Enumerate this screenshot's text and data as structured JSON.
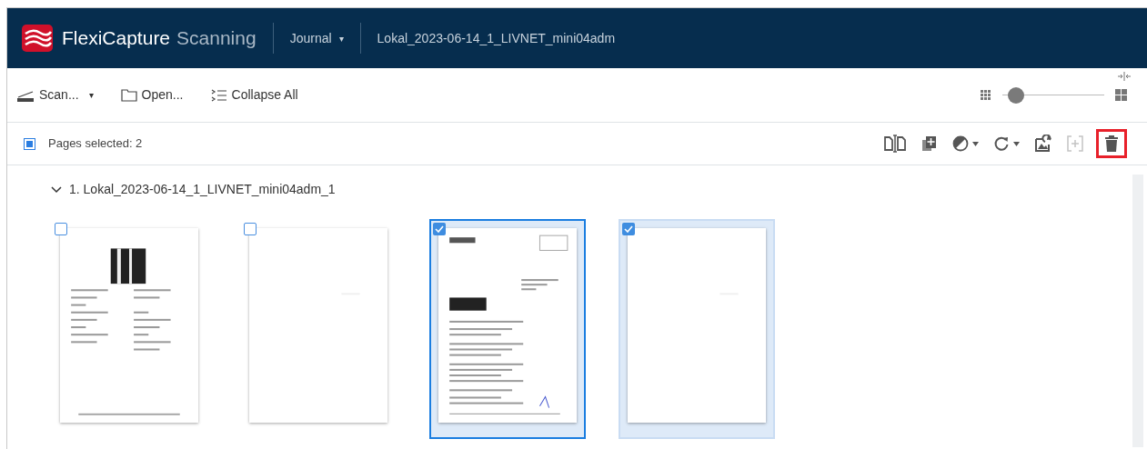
{
  "header": {
    "brand": "FlexiCapture",
    "brand_suffix": "Scanning",
    "menu": "Journal",
    "caret": "▾",
    "batch_name": "Lokal_2023-06-14_1_LIVNET_mini04adm"
  },
  "toolbar": {
    "items": [
      {
        "label": "Scan...",
        "kind": "scan",
        "caret": "▾"
      },
      {
        "label": "Open...",
        "kind": "open"
      },
      {
        "label": "Collapse All",
        "kind": "collapse"
      }
    ],
    "zoom": {
      "level": 0.05
    }
  },
  "selection_bar": {
    "checked": true,
    "label": "Pages selected: 2",
    "tools": [
      {
        "kind": "split",
        "disabled": false,
        "has_menu": false,
        "highlighted": false
      },
      {
        "kind": "add-page",
        "disabled": false,
        "has_menu": false,
        "highlighted": false
      },
      {
        "kind": "color",
        "disabled": false,
        "has_menu": true,
        "highlighted": false
      },
      {
        "kind": "rotate",
        "disabled": false,
        "has_menu": true,
        "highlighted": false
      },
      {
        "kind": "edit-image",
        "disabled": false,
        "has_menu": false,
        "highlighted": false
      },
      {
        "kind": "insert",
        "disabled": true,
        "has_menu": false,
        "highlighted": false
      },
      {
        "kind": "delete",
        "disabled": false,
        "has_menu": false,
        "highlighted": true
      }
    ]
  },
  "document": {
    "expanded": true,
    "title": "1. Lokal_2023-06-14_1_LIVNET_mini04adm_1",
    "pages": [
      {
        "kind": "form",
        "selected": false,
        "focused": false
      },
      {
        "kind": "blank",
        "selected": false,
        "focused": false
      },
      {
        "kind": "letter",
        "selected": true,
        "focused": true
      },
      {
        "kind": "blank",
        "selected": true,
        "focused": false
      }
    ]
  }
}
